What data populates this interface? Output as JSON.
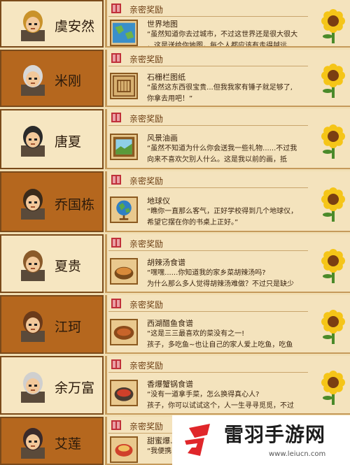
{
  "reward_title": "亲密奖励",
  "rows": [
    {
      "name": "虞安然",
      "item": "世界地图",
      "desc": "“虽然知道你去过城市，不过这世界还是很大很大\n，这是送给你地图，每个人都应该有走得越远、",
      "icon": "map-icon",
      "shade": "light"
    },
    {
      "name": "米刚",
      "item": "石栅栏图纸",
      "desc": "“虽然这东西很宝贵...但我我家有锤子就足够了,\n你拿去用吧！”",
      "icon": "blueprint-icon",
      "shade": "dark"
    },
    {
      "name": "唐夏",
      "item": "风景油画",
      "desc": "“虽然不知道为什么你会送我一些礼物......不过我\n向来不喜欢欠别人什么。这是我以前的画，抵",
      "icon": "painting-icon",
      "shade": "light"
    },
    {
      "name": "乔国栋",
      "item": "地球仪",
      "desc": "“瞧你一直那么客气，正好学校得到几个地球仪，\n希望它摆在你的书桌上正好。”",
      "icon": "globe-icon",
      "shade": "dark"
    },
    {
      "name": "夏贵",
      "item": "胡辣汤食谱",
      "desc": "“嘿嘿......你知道我的家乡菜胡辣汤吗?\n为什么那么多人觉得胡辣汤难做？不过只是缺少",
      "icon": "soup-icon",
      "shade": "light"
    },
    {
      "name": "江珂",
      "item": "西湖醋鱼食谱",
      "desc": "“这是三三最喜欢的菜没有之一!\n孩子，多吃鱼~也让自己的家人爱上吃鱼，吃鱼",
      "icon": "fish-icon",
      "shade": "dark"
    },
    {
      "name": "余万富",
      "item": "香爆蟹锅食谱",
      "desc": "“没有一道拿手菜，怎么换得真心人?\n孩子，你可以试试这个，人一生寻寻觅觅，不过",
      "icon": "crab-pot-icon",
      "shade": "light"
    },
    {
      "name": "艾莲",
      "item": "甜蜜爆…",
      "desc": "“我便携的",
      "icon": "dessert-icon",
      "shade": "dark"
    }
  ],
  "watermark": {
    "text": "雷羽手游网",
    "url": "www.leiucn.com",
    "colors": {
      "red": "#e0262a",
      "black": "#1d1d1d"
    }
  },
  "colors": {
    "bg": "#f1dfb4",
    "panel_dark": "#b5671e",
    "panel_light": "#f6e6c1",
    "border": "#7a4a1a"
  }
}
